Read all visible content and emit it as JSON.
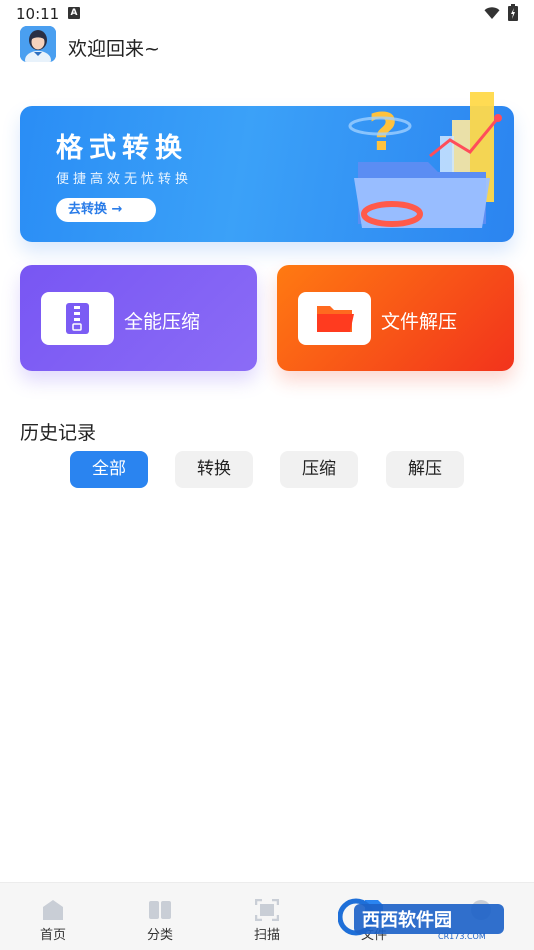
{
  "status_bar": {
    "time": "10:11",
    "notification_badge": "A"
  },
  "header": {
    "greeting": "欢迎回来~"
  },
  "banner": {
    "title": "格式转换",
    "subtitle": "便捷高效无忧转换",
    "button_label": "去转换 →"
  },
  "tiles": {
    "compress_label": "全能压缩",
    "extract_label": "文件解压"
  },
  "history": {
    "title": "历史记录",
    "tabs": [
      {
        "label": "全部",
        "active": true
      },
      {
        "label": "转换",
        "active": false
      },
      {
        "label": "压缩",
        "active": false
      },
      {
        "label": "解压",
        "active": false
      }
    ]
  },
  "bottom_nav": {
    "items": [
      {
        "label": "首页",
        "icon": "home-icon"
      },
      {
        "label": "分类",
        "icon": "category-icon"
      },
      {
        "label": "扫描",
        "icon": "scan-icon"
      },
      {
        "label": "文件",
        "icon": "file-icon"
      },
      {
        "label": "",
        "icon": "profile-icon"
      }
    ]
  },
  "watermark": {
    "text": "西西软件园",
    "subtext": "CR173.COM"
  },
  "colors": {
    "primary": "#2a84f0",
    "compress": "#7856f3",
    "extract": "#f2331c"
  }
}
